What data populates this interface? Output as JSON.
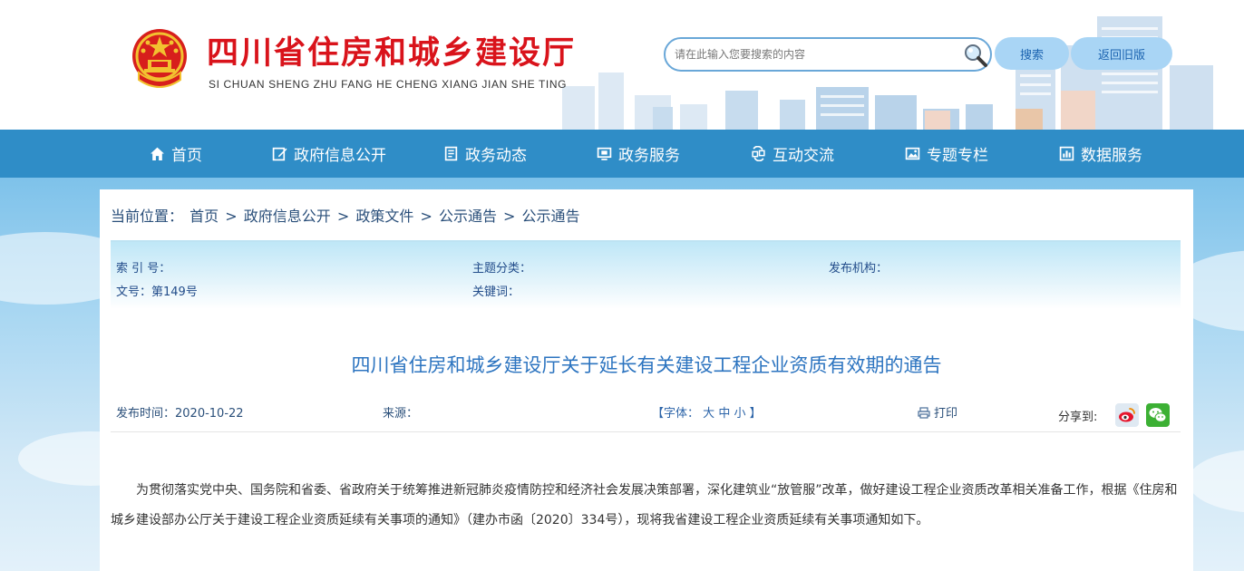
{
  "header": {
    "title": "四川省住房和城乡建设厅",
    "subtitle": "SI CHUAN SHENG ZHU FANG HE CHENG XIANG JIAN SHE TING",
    "search_placeholder": "请在此输入您要搜索的内容",
    "search_button": "搜索",
    "old_version_button": "返回旧版",
    "colors": {
      "title_red": "#d9131b",
      "nav_blue": "#2f8dc7",
      "button_blue": "#a9d5f5"
    }
  },
  "nav": {
    "items": [
      {
        "label": "首页",
        "icon": "home-icon"
      },
      {
        "label": "政府信息公开",
        "icon": "edit-icon"
      },
      {
        "label": "政务动态",
        "icon": "document-icon"
      },
      {
        "label": "政务服务",
        "icon": "monitor-icon"
      },
      {
        "label": "互动交流",
        "icon": "interaction-icon"
      },
      {
        "label": "专题专栏",
        "icon": "image-icon"
      },
      {
        "label": "数据服务",
        "icon": "chart-icon"
      }
    ]
  },
  "breadcrumb": {
    "prefix": "当前位置：",
    "separator": ">",
    "items": [
      "首页",
      "政府信息公开",
      "政策文件",
      "公示通告",
      "公示通告"
    ]
  },
  "meta": {
    "index_label": "索 引 号：",
    "topic_label": "主题分类：",
    "publisher_label": "发布机构：",
    "doc_number": "文号：第149号",
    "keywords_label": "关键词："
  },
  "article": {
    "title": "四川省住房和城乡建设厅关于延长有关建设工程企业资质有效期的通告",
    "publish_time": "发布时间：2020-10-22",
    "source_label": "来源：",
    "font_size_prefix": "【字体：",
    "font_large": "大",
    "font_medium": "中",
    "font_small": "小",
    "font_size_suffix": "】",
    "print_label": "打印",
    "share_label": "分享到:",
    "share_icons": [
      "weibo-icon",
      "wechat-icon"
    ],
    "paragraph": "为贯彻落实党中央、国务院和省委、省政府关于统筹推进新冠肺炎疫情防控和经济社会发展决策部署，深化建筑业“放管服”改革，做好建设工程企业资质改革相关准备工作，根据《住房和城乡建设部办公厅关于建设工程企业资质延续有关事项的通知》（建办市函〔2020〕334号），现将我省建设工程企业资质延续有关事项通知如下。"
  }
}
